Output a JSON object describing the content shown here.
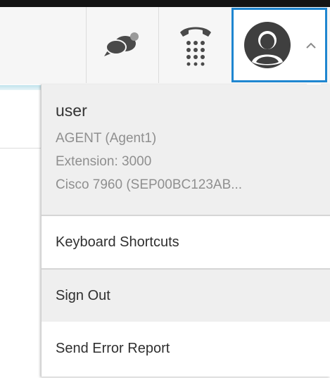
{
  "header": {
    "icons": {
      "chat": "chat-bubbles-icon",
      "phone": "dialpad-phone-icon",
      "user": "user-avatar-icon",
      "chevron": "chevron-up-icon"
    },
    "colors": {
      "accent_border": "#1f86d0",
      "icon": "#4a4a4a"
    }
  },
  "user_menu": {
    "username": "user",
    "role": "AGENT (Agent1)",
    "extension": "Extension: 3000",
    "device": "Cisco 7960 (SEP00BC123AB..."
  },
  "menu_items": {
    "keyboard_shortcuts": "Keyboard Shortcuts",
    "sign_out": "Sign Out",
    "send_error_report": "Send Error Report"
  }
}
